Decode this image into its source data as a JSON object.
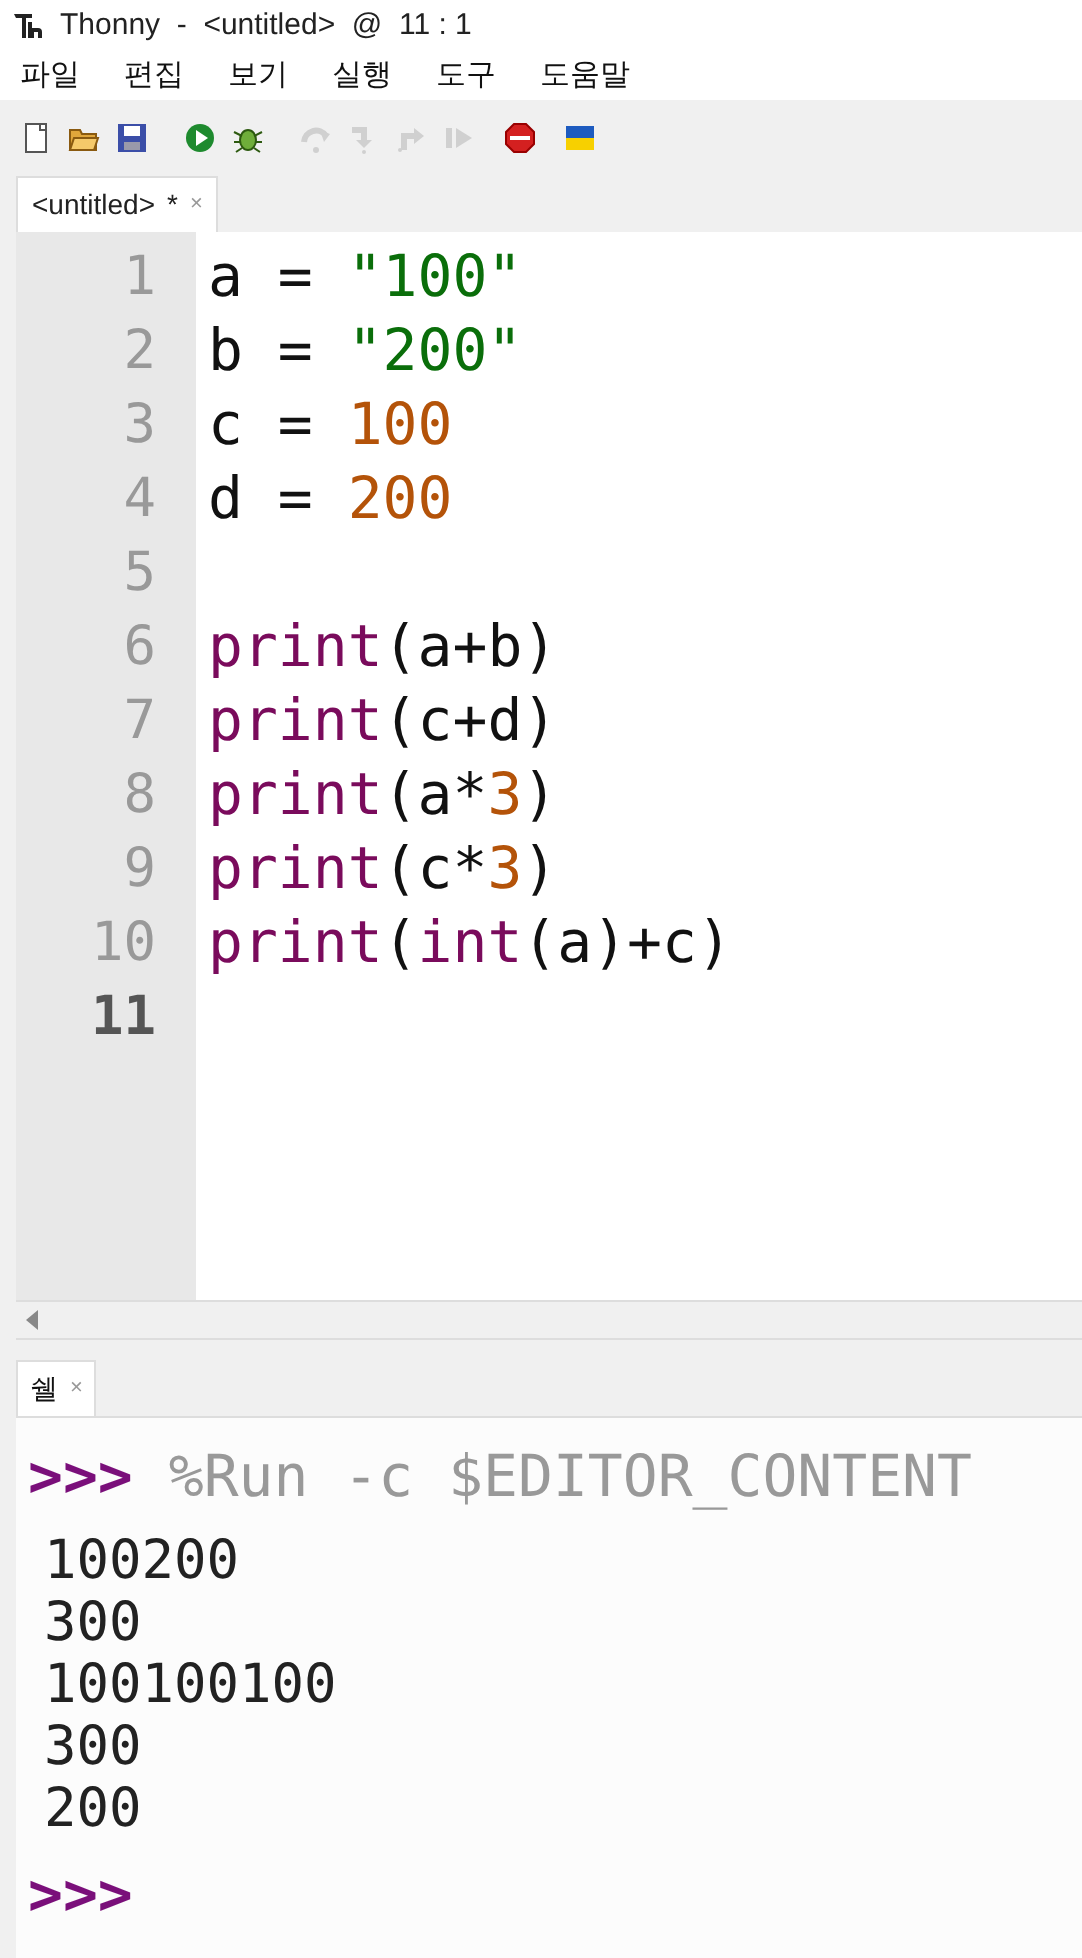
{
  "window": {
    "title": "Thonny  -  <untitled>  @  11 : 1"
  },
  "menu": [
    "파일",
    "편집",
    "보기",
    "실행",
    "도구",
    "도움말"
  ],
  "toolbar": [
    {
      "kind": "new",
      "disabled": false
    },
    {
      "kind": "open",
      "disabled": false
    },
    {
      "kind": "save",
      "disabled": false
    },
    {
      "kind": "run",
      "disabled": false
    },
    {
      "kind": "debug",
      "disabled": false
    },
    {
      "kind": "step_over",
      "disabled": true
    },
    {
      "kind": "step_into",
      "disabled": true
    },
    {
      "kind": "step_out",
      "disabled": true
    },
    {
      "kind": "resume",
      "disabled": true
    },
    {
      "kind": "stop",
      "disabled": false
    },
    {
      "kind": "flag",
      "disabled": false
    }
  ],
  "editor_tab": {
    "label": "<untitled>",
    "modified_mark": "*",
    "close": "×"
  },
  "editor": {
    "lines": [
      {
        "number": "1",
        "current": false,
        "tokens": [
          {
            "kind": "name",
            "text": "a = "
          },
          {
            "kind": "string",
            "text": "\"100\""
          }
        ]
      },
      {
        "number": "2",
        "current": false,
        "tokens": [
          {
            "kind": "name",
            "text": "b = "
          },
          {
            "kind": "string",
            "text": "\"200\""
          }
        ]
      },
      {
        "number": "3",
        "current": false,
        "tokens": [
          {
            "kind": "name",
            "text": "c = "
          },
          {
            "kind": "number",
            "text": "100"
          }
        ]
      },
      {
        "number": "4",
        "current": false,
        "tokens": [
          {
            "kind": "name",
            "text": "d = "
          },
          {
            "kind": "number",
            "text": "200"
          }
        ]
      },
      {
        "number": "5",
        "current": false
      },
      {
        "number": "6",
        "current": false,
        "tokens": [
          {
            "kind": "builtin",
            "text": "print"
          },
          {
            "kind": "name",
            "text": "(a+b)"
          }
        ]
      },
      {
        "number": "7",
        "current": false,
        "tokens": [
          {
            "kind": "builtin",
            "text": "print"
          },
          {
            "kind": "name",
            "text": "(c+d)"
          }
        ]
      },
      {
        "number": "8",
        "current": false,
        "tokens": [
          {
            "kind": "builtin",
            "text": "print"
          },
          {
            "kind": "name",
            "text": "(a*"
          },
          {
            "kind": "number",
            "text": "3"
          },
          {
            "kind": "name",
            "text": ")"
          }
        ]
      },
      {
        "number": "9",
        "current": false,
        "tokens": [
          {
            "kind": "builtin",
            "text": "print"
          },
          {
            "kind": "name",
            "text": "(c*"
          },
          {
            "kind": "number",
            "text": "3"
          },
          {
            "kind": "name",
            "text": ")"
          }
        ]
      },
      {
        "number": "10",
        "current": false,
        "tokens": [
          {
            "kind": "builtin",
            "text": "print"
          },
          {
            "kind": "name",
            "text": "("
          },
          {
            "kind": "builtin",
            "text": "int"
          },
          {
            "kind": "name",
            "text": "(a)+c)"
          }
        ]
      },
      {
        "number": "11",
        "current": true
      }
    ]
  },
  "shell_tab": {
    "label": "쉘",
    "close": "×"
  },
  "shell": {
    "lines": [
      {
        "kind": "command",
        "prompt": ">>>",
        "text": "%Run -c $EDITOR_CONTENT"
      },
      {
        "kind": "output",
        "text": "100200"
      },
      {
        "kind": "output",
        "text": "300"
      },
      {
        "kind": "output",
        "text": "100100100"
      },
      {
        "kind": "output",
        "text": "300"
      },
      {
        "kind": "output",
        "text": "200"
      },
      {
        "kind": "prompt",
        "prompt": ">>>"
      }
    ]
  }
}
